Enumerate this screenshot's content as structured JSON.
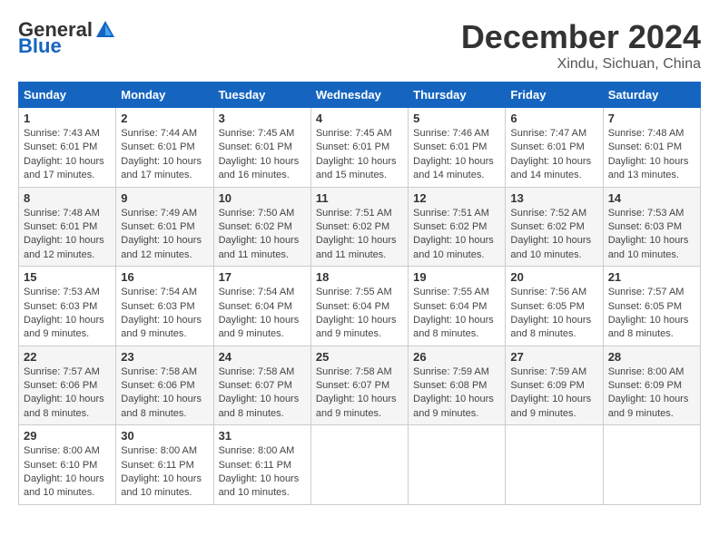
{
  "header": {
    "logo_general": "General",
    "logo_blue": "Blue",
    "month_title": "December 2024",
    "location": "Xindu, Sichuan, China"
  },
  "calendar": {
    "days_of_week": [
      "Sunday",
      "Monday",
      "Tuesday",
      "Wednesday",
      "Thursday",
      "Friday",
      "Saturday"
    ],
    "weeks": [
      [
        {
          "day": "1",
          "sunrise": "7:43 AM",
          "sunset": "6:01 PM",
          "daylight": "10 hours and 17 minutes."
        },
        {
          "day": "2",
          "sunrise": "7:44 AM",
          "sunset": "6:01 PM",
          "daylight": "10 hours and 17 minutes."
        },
        {
          "day": "3",
          "sunrise": "7:45 AM",
          "sunset": "6:01 PM",
          "daylight": "10 hours and 16 minutes."
        },
        {
          "day": "4",
          "sunrise": "7:45 AM",
          "sunset": "6:01 PM",
          "daylight": "10 hours and 15 minutes."
        },
        {
          "day": "5",
          "sunrise": "7:46 AM",
          "sunset": "6:01 PM",
          "daylight": "10 hours and 14 minutes."
        },
        {
          "day": "6",
          "sunrise": "7:47 AM",
          "sunset": "6:01 PM",
          "daylight": "10 hours and 14 minutes."
        },
        {
          "day": "7",
          "sunrise": "7:48 AM",
          "sunset": "6:01 PM",
          "daylight": "10 hours and 13 minutes."
        }
      ],
      [
        {
          "day": "8",
          "sunrise": "7:48 AM",
          "sunset": "6:01 PM",
          "daylight": "10 hours and 12 minutes."
        },
        {
          "day": "9",
          "sunrise": "7:49 AM",
          "sunset": "6:01 PM",
          "daylight": "10 hours and 12 minutes."
        },
        {
          "day": "10",
          "sunrise": "7:50 AM",
          "sunset": "6:02 PM",
          "daylight": "10 hours and 11 minutes."
        },
        {
          "day": "11",
          "sunrise": "7:51 AM",
          "sunset": "6:02 PM",
          "daylight": "10 hours and 11 minutes."
        },
        {
          "day": "12",
          "sunrise": "7:51 AM",
          "sunset": "6:02 PM",
          "daylight": "10 hours and 10 minutes."
        },
        {
          "day": "13",
          "sunrise": "7:52 AM",
          "sunset": "6:02 PM",
          "daylight": "10 hours and 10 minutes."
        },
        {
          "day": "14",
          "sunrise": "7:53 AM",
          "sunset": "6:03 PM",
          "daylight": "10 hours and 10 minutes."
        }
      ],
      [
        {
          "day": "15",
          "sunrise": "7:53 AM",
          "sunset": "6:03 PM",
          "daylight": "10 hours and 9 minutes."
        },
        {
          "day": "16",
          "sunrise": "7:54 AM",
          "sunset": "6:03 PM",
          "daylight": "10 hours and 9 minutes."
        },
        {
          "day": "17",
          "sunrise": "7:54 AM",
          "sunset": "6:04 PM",
          "daylight": "10 hours and 9 minutes."
        },
        {
          "day": "18",
          "sunrise": "7:55 AM",
          "sunset": "6:04 PM",
          "daylight": "10 hours and 9 minutes."
        },
        {
          "day": "19",
          "sunrise": "7:55 AM",
          "sunset": "6:04 PM",
          "daylight": "10 hours and 8 minutes."
        },
        {
          "day": "20",
          "sunrise": "7:56 AM",
          "sunset": "6:05 PM",
          "daylight": "10 hours and 8 minutes."
        },
        {
          "day": "21",
          "sunrise": "7:57 AM",
          "sunset": "6:05 PM",
          "daylight": "10 hours and 8 minutes."
        }
      ],
      [
        {
          "day": "22",
          "sunrise": "7:57 AM",
          "sunset": "6:06 PM",
          "daylight": "10 hours and 8 minutes."
        },
        {
          "day": "23",
          "sunrise": "7:58 AM",
          "sunset": "6:06 PM",
          "daylight": "10 hours and 8 minutes."
        },
        {
          "day": "24",
          "sunrise": "7:58 AM",
          "sunset": "6:07 PM",
          "daylight": "10 hours and 8 minutes."
        },
        {
          "day": "25",
          "sunrise": "7:58 AM",
          "sunset": "6:07 PM",
          "daylight": "10 hours and 9 minutes."
        },
        {
          "day": "26",
          "sunrise": "7:59 AM",
          "sunset": "6:08 PM",
          "daylight": "10 hours and 9 minutes."
        },
        {
          "day": "27",
          "sunrise": "7:59 AM",
          "sunset": "6:09 PM",
          "daylight": "10 hours and 9 minutes."
        },
        {
          "day": "28",
          "sunrise": "8:00 AM",
          "sunset": "6:09 PM",
          "daylight": "10 hours and 9 minutes."
        }
      ],
      [
        {
          "day": "29",
          "sunrise": "8:00 AM",
          "sunset": "6:10 PM",
          "daylight": "10 hours and 10 minutes."
        },
        {
          "day": "30",
          "sunrise": "8:00 AM",
          "sunset": "6:11 PM",
          "daylight": "10 hours and 10 minutes."
        },
        {
          "day": "31",
          "sunrise": "8:00 AM",
          "sunset": "6:11 PM",
          "daylight": "10 hours and 10 minutes."
        },
        null,
        null,
        null,
        null
      ]
    ]
  }
}
